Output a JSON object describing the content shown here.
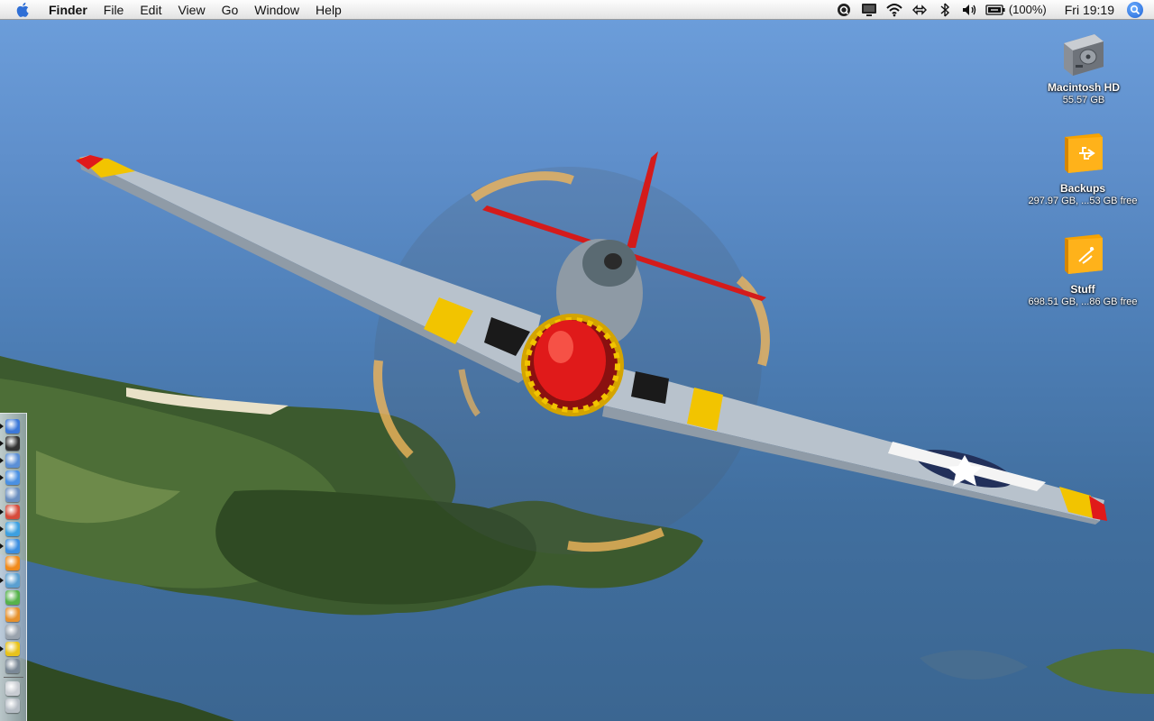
{
  "menubar": {
    "app_name": "Finder",
    "menus": [
      "File",
      "Edit",
      "View",
      "Go",
      "Window",
      "Help"
    ],
    "battery_percent": "(100%)",
    "clock": "Fri 19:19"
  },
  "desktop_icons": [
    {
      "name": "Macintosh HD",
      "sub": "55.57 GB",
      "icon": "internal-hard-drive-icon"
    },
    {
      "name": "Backups",
      "sub": "297.97 GB, ...53 GB free",
      "icon": "external-usb-drive-icon"
    },
    {
      "name": "Stuff",
      "sub": "698.51 GB, ...86 GB free",
      "icon": "external-firewire-drive-icon"
    }
  ],
  "dock_items": [
    {
      "icon": "finder-icon",
      "color": "#3c78d8"
    },
    {
      "icon": "dashboard-icon",
      "color": "#333333"
    },
    {
      "icon": "mail-icon",
      "color": "#5b8fd6"
    },
    {
      "icon": "safari-icon",
      "color": "#4a90e2"
    },
    {
      "icon": "preview-icon",
      "color": "#6b8fc0"
    },
    {
      "icon": "ical-icon",
      "color": "#d64b3b"
    },
    {
      "icon": "itunes-icon",
      "color": "#3da0e0"
    },
    {
      "icon": "ichat-icon",
      "color": "#3c8ee0"
    },
    {
      "icon": "vlc-icon",
      "color": "#f08a1c"
    },
    {
      "icon": "transmission-icon",
      "color": "#5a9fd0"
    },
    {
      "icon": "leaf-icon",
      "color": "#56b24b"
    },
    {
      "icon": "coda-icon",
      "color": "#e6912d"
    },
    {
      "icon": "camera-icon",
      "color": "#9aa3ad"
    },
    {
      "icon": "adium-icon",
      "color": "#e8c21a"
    },
    {
      "icon": "system-preferences-icon",
      "color": "#7a8896"
    },
    {
      "icon": "documents-stack-icon",
      "color": "#c8ccd2"
    },
    {
      "icon": "trash-icon",
      "color": "#b5bcc4"
    }
  ],
  "colors": {
    "sky": "#6d9fdc",
    "water": "#416f9f",
    "plane_red": "#e01a1a",
    "plane_yellow": "#f2c400",
    "drive_orange": "#f7a300"
  }
}
